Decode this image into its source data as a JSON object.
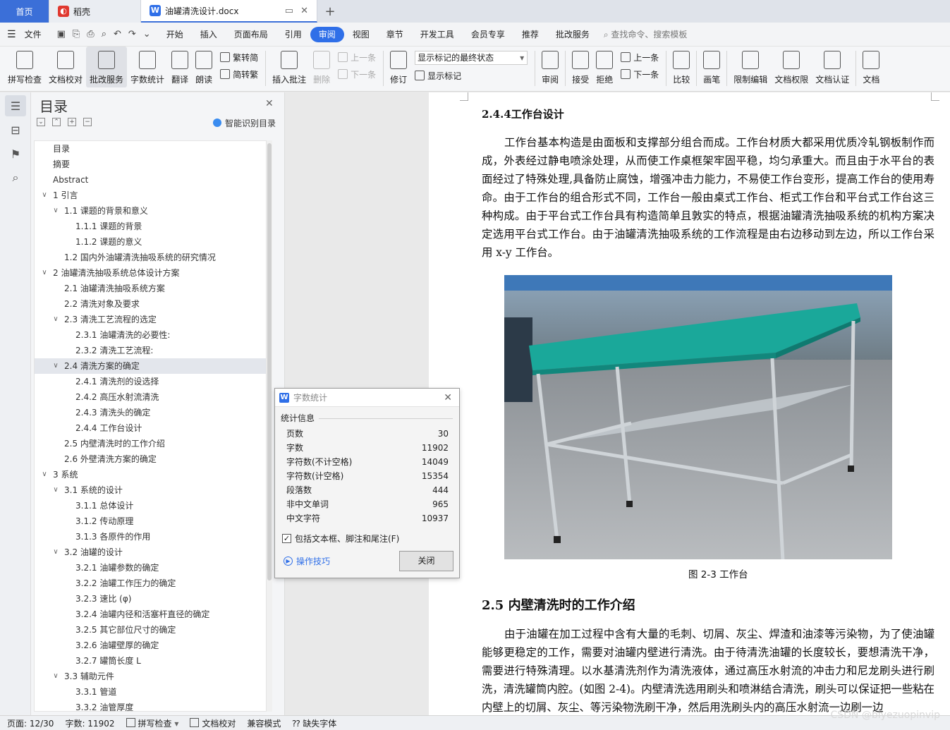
{
  "tabs": {
    "home": "首页",
    "daoke": "稻壳",
    "doc": "油罐清洗设计.docx",
    "add": "+"
  },
  "menu": {
    "file": "文件",
    "items": [
      "开始",
      "插入",
      "页面布局",
      "引用",
      "审阅",
      "视图",
      "章节",
      "开发工具",
      "会员专享",
      "推荐",
      "批改服务"
    ],
    "active_index": 4,
    "search_placeholder": "查找命令、搜索模板"
  },
  "ribbon": {
    "spellcheck": "拼写检查",
    "doc_check": "文档校对",
    "correction_service": "批改服务",
    "word_count": "字数统计",
    "translate": "翻译",
    "read_aloud": "朗读",
    "trad_simp": "繁转简",
    "simp_trad": "简转繁",
    "insert_comment": "插入批注",
    "delete": "删除",
    "prev": "上一条",
    "next": "下一条",
    "track": "修订",
    "markup_select": "显示标记的最终状态",
    "show_markup": "显示标记",
    "review": "审阅",
    "accept": "接受",
    "reject": "拒绝",
    "prev2": "上一条",
    "next2": "下一条",
    "compare": "比较",
    "pen": "画笔",
    "restrict_edit": "限制编辑",
    "doc_rights": "文档权限",
    "doc_cert": "文档认证",
    "doc_more": "文档"
  },
  "toc": {
    "title": "目录",
    "smart": "智能识别目录",
    "items": [
      {
        "label": "目录",
        "level": 0,
        "caret": ""
      },
      {
        "label": "摘要",
        "level": 0,
        "caret": ""
      },
      {
        "label": "Abstract",
        "level": 0,
        "caret": ""
      },
      {
        "label": "1 引言",
        "level": 0,
        "caret": "v"
      },
      {
        "label": "1.1 课题的背景和意义",
        "level": 1,
        "caret": "v"
      },
      {
        "label": "1.1.1 课题的背景",
        "level": 2,
        "caret": ""
      },
      {
        "label": "1.1.2 课题的意义",
        "level": 2,
        "caret": ""
      },
      {
        "label": "1.2 国内外油罐清洗抽吸系统的研究情况",
        "level": 1,
        "caret": ""
      },
      {
        "label": "2 油罐清洗抽吸系统总体设计方案",
        "level": 0,
        "caret": "v"
      },
      {
        "label": "2.1 油罐清洗抽吸系统方案",
        "level": 1,
        "caret": ""
      },
      {
        "label": "2.2 清洗对象及要求",
        "level": 1,
        "caret": ""
      },
      {
        "label": "2.3 清洗工艺流程的选定",
        "level": 1,
        "caret": "v"
      },
      {
        "label": "2.3.1 油罐清洗的必要性:",
        "level": 2,
        "caret": ""
      },
      {
        "label": "2.3.2 清洗工艺流程:",
        "level": 2,
        "caret": ""
      },
      {
        "label": "2.4 清洗方案的确定",
        "level": 1,
        "caret": "v",
        "highlight": true
      },
      {
        "label": "2.4.1 清洗剂的设选择",
        "level": 2,
        "caret": ""
      },
      {
        "label": "2.4.2 高压水射流清洗",
        "level": 2,
        "caret": ""
      },
      {
        "label": "2.4.3 清洗头的确定",
        "level": 2,
        "caret": ""
      },
      {
        "label": "2.4.4 工作台设计",
        "level": 2,
        "caret": ""
      },
      {
        "label": "2.5  内壁清洗时的工作介绍",
        "level": 1,
        "caret": ""
      },
      {
        "label": "2.6  外壁清洗方案的确定",
        "level": 1,
        "caret": ""
      },
      {
        "label": "3 系统",
        "level": 0,
        "caret": "v"
      },
      {
        "label": "3.1 系统的设计",
        "level": 1,
        "caret": "v"
      },
      {
        "label": "3.1.1 总体设计",
        "level": 2,
        "caret": ""
      },
      {
        "label": "3.1.2 传动原理",
        "level": 2,
        "caret": ""
      },
      {
        "label": "3.1.3 各原件的作用",
        "level": 2,
        "caret": ""
      },
      {
        "label": "3.2 油罐的设计",
        "level": 1,
        "caret": "v"
      },
      {
        "label": "3.2.1 油罐参数的确定",
        "level": 2,
        "caret": ""
      },
      {
        "label": "3.2.2 油罐工作压力的确定",
        "level": 2,
        "caret": ""
      },
      {
        "label": "3.2.3    速比  (φ)",
        "level": 2,
        "caret": ""
      },
      {
        "label": "3.2.4  油罐内径和活塞杆直径的确定",
        "level": 2,
        "caret": ""
      },
      {
        "label": "3.2.5 其它部位尺寸的确定",
        "level": 2,
        "caret": ""
      },
      {
        "label": "3.2.6 油罐壁厚的确定",
        "level": 2,
        "caret": ""
      },
      {
        "label": "3.2.7    罐筒长度 L",
        "level": 2,
        "caret": ""
      },
      {
        "label": "3.3 辅助元件",
        "level": 1,
        "caret": "v"
      },
      {
        "label": "3.3.1 管道",
        "level": 2,
        "caret": ""
      },
      {
        "label": "3.3.2 油管厚度",
        "level": 2,
        "caret": ""
      }
    ]
  },
  "document": {
    "heading_244": "2.4.4工作台设计",
    "para1": "工作台基本构造是由面板和支撑部分组合而成。工作台材质大都采用优质冷轧钢板制作而成，外表经过静电喷涂处理，从而使工作桌框架牢固平稳，均匀承重大。而且由于水平台的表面经过了特殊处理,具备防止腐蚀，增强冲击力能力，不易使工作台变形，提高工作台的使用寿命。由于工作台的组合形式不同，工作台一般由桌式工作台、柜式工作台和平台式工作台这三种构成。由于平台式工作台具有构造简单且敦实的特点，根据油罐清洗抽吸系统的机构方案决定选用平台式工作台。由于油罐清洗抽吸系统的工作流程是由右边移动到左边，所以工作台采用 x-y 工作台。",
    "caption": "图 2-3  工作台",
    "heading_25": "2.5  内壁清洗时的工作介绍",
    "para2": "由于油罐在加工过程中含有大量的毛刺、切屑、灰尘、焊渣和油漆等污染物，为了使油罐能够更稳定的工作，需要对油罐内壁进行清洗。由于待清洗油罐的长度较长，要想清洗干净，需要进行特殊清理。以水基清洗剂作为清洗液体，通过高压水射流的冲击力和尼龙刷头进行刷洗，清洗罐筒内腔。(如图 2-4)。内壁清洗选用刷头和喷淋结合清洗，刷头可以保证把一些粘在内壁上的切屑、灰尘、等污染物洗刷干净，然后用洗刷头内的高压水射流一边刷一边"
  },
  "dialog": {
    "title": "字数统计",
    "section": "统计信息",
    "stats": [
      {
        "label": "页数",
        "value": "30"
      },
      {
        "label": "字数",
        "value": "11902"
      },
      {
        "label": "字符数(不计空格)",
        "value": "14049"
      },
      {
        "label": "字符数(计空格)",
        "value": "15354"
      },
      {
        "label": "段落数",
        "value": "444"
      },
      {
        "label": "非中文单词",
        "value": "965"
      },
      {
        "label": "中文字符",
        "value": "10937"
      }
    ],
    "checkbox": "包括文本框、脚注和尾注(F)",
    "tips": "操作技巧",
    "close": "关闭"
  },
  "status": {
    "page": "页面: 12/30",
    "words": "字数: 11902",
    "spell": "拼写检查",
    "doccheck": "文档校对",
    "compat": "兼容模式",
    "missing_font": "缺失字体"
  },
  "watermark": "CSDN @biyezuopinvip",
  "colors": {
    "accent": "#2f6fe8",
    "home_tab": "#3b6fd8",
    "tabletop": "#1aa89a"
  }
}
